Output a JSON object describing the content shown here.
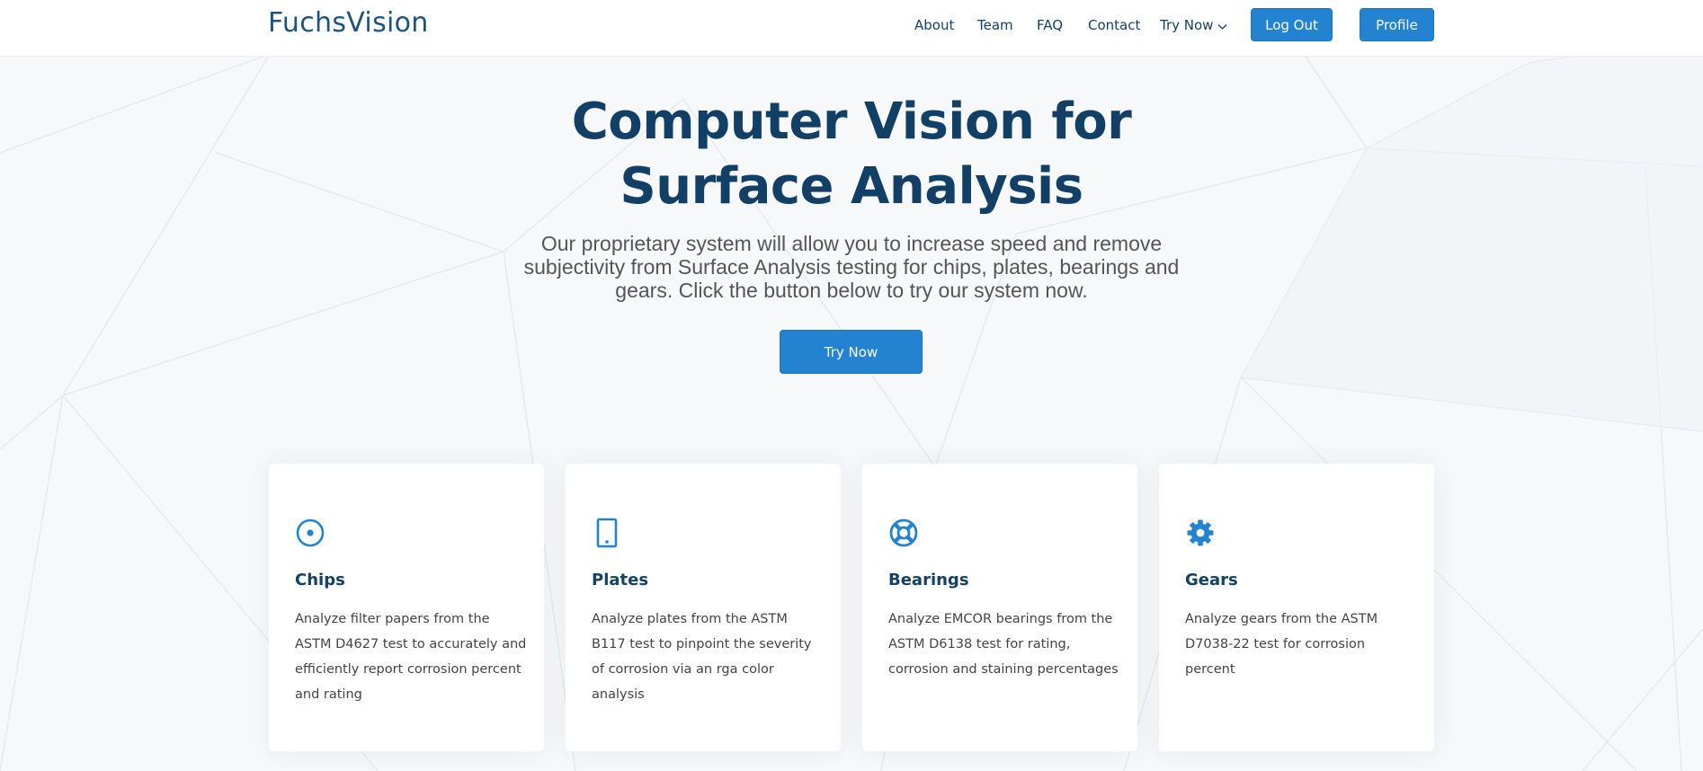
{
  "brand": {
    "logo": "FuchsVision"
  },
  "nav": {
    "about": "About",
    "team": "Team",
    "faq": "FAQ",
    "contact": "Contact",
    "try_now": "Try Now",
    "log_out": "Log Out",
    "profile": "Profile"
  },
  "hero": {
    "title": "Computer Vision for Surface Analysis",
    "subtitle": "Our proprietary system will allow you to increase speed and remove subjectivity from Surface Analysis testing for chips, plates, bearings and gears. Click the button below to try our system now.",
    "cta": "Try Now"
  },
  "cards": [
    {
      "icon": "target-icon",
      "title": "Chips",
      "description": "Analyze filter papers from the ASTM D4627 test to accurately and efficiently report corrosion percent and rating"
    },
    {
      "icon": "tablet-icon",
      "title": "Plates",
      "description": "Analyze plates from the ASTM B117 test to pinpoint the severity of corrosion via an rga color analysis"
    },
    {
      "icon": "life-ring-icon",
      "title": "Bearings",
      "description": "Analyze EMCOR bearings from the ASTM D6138 test for rating, corrosion and staining percentages"
    },
    {
      "icon": "gear-icon",
      "title": "Gears",
      "description": "Analyze gears from the ASTM D7038-22 test for corrosion percent"
    }
  ],
  "colors": {
    "primary": "#2383d1",
    "heading": "#124265",
    "title": "#123f66",
    "logo": "#1d5383",
    "background": "#f6f8fa",
    "body_text": "#444444"
  }
}
